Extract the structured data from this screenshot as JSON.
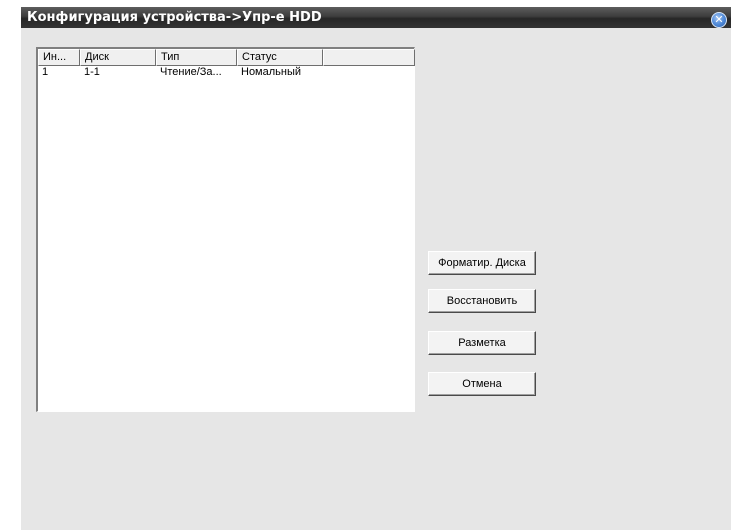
{
  "window": {
    "title": "Конфигурация устройства->Упр-е HDD",
    "close_icon": "close-icon"
  },
  "table": {
    "columns": [
      "Ин...",
      "Диск",
      "Тип",
      "Статус",
      ""
    ],
    "rows": [
      [
        "1",
        "1-1",
        "Чтение/За...",
        "Номальный",
        ""
      ]
    ]
  },
  "buttons": {
    "format": "Форматир. Диска",
    "restore": "Восстановить",
    "partition": "Разметка",
    "cancel": "Отмена"
  },
  "colors": {
    "window_bg": "#e6e6e6",
    "titlebar": "#333333",
    "close_button": "#4d87d6"
  }
}
